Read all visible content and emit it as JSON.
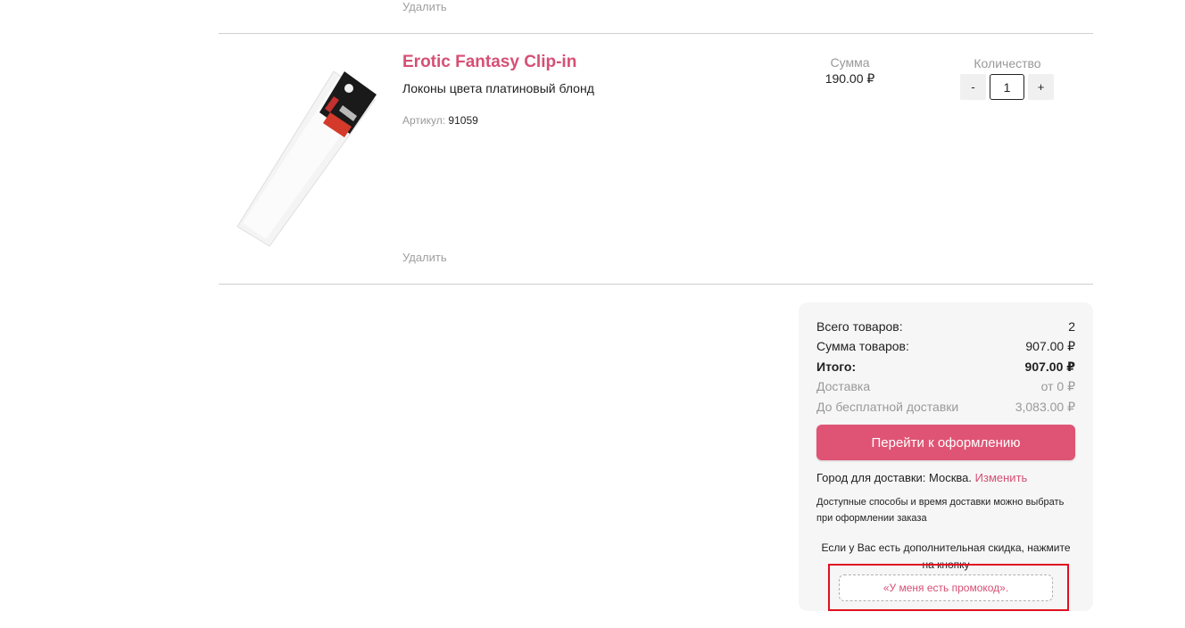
{
  "previous_item": {
    "delete_label": "Удалить"
  },
  "item": {
    "title": "Erotic Fantasy Clip-in",
    "subtitle": "Локоны цвета платиновый блонд",
    "sku_label": "Артикул:",
    "sku_value": "91059",
    "sum_label": "Сумма",
    "sum_value": "190.00 ₽",
    "qty_label": "Количество",
    "qty_minus": "-",
    "qty_value": "1",
    "qty_plus": "+",
    "delete_label": "Удалить"
  },
  "summary": {
    "rows": [
      {
        "label": "Всего товаров:",
        "value": "2"
      },
      {
        "label": "Сумма товаров:",
        "value": "907.00 ₽"
      },
      {
        "label": "Итого:",
        "value": "907.00 ₽"
      },
      {
        "label": "Доставка",
        "value": "от 0 ₽"
      },
      {
        "label": "До бесплатной доставки",
        "value": "3,083.00 ₽"
      }
    ],
    "checkout_label": "Перейти к оформлению",
    "city_prefix": "Город для доставки: Москва.",
    "city_change": "Изменить",
    "delivery_note": "Доступные способы и время доставки можно выбрать при оформлении заказа",
    "promo_text": "Если у Вас есть дополнительная скидка, нажмите на кнопку",
    "promo_button": "«У меня есть промокод».",
    "accent_color": "#df5474",
    "highlight_color": "#e01020"
  }
}
